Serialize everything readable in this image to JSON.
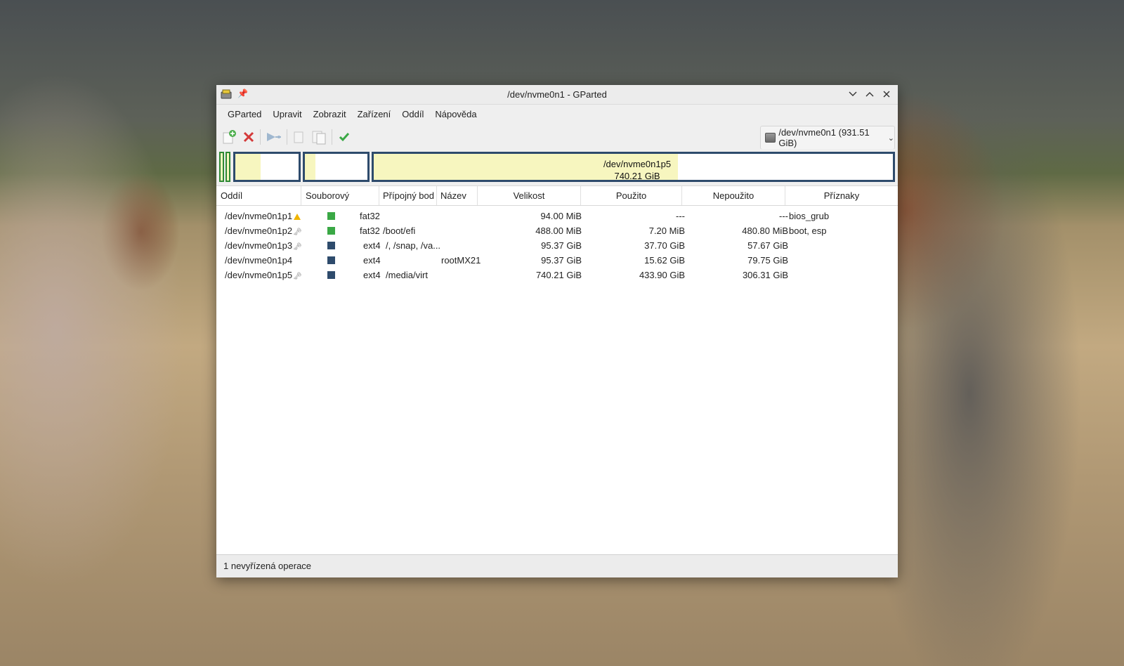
{
  "window": {
    "title": "/dev/nvme0n1 - GParted",
    "controls": [
      "minimize",
      "maximize",
      "close"
    ]
  },
  "menu": [
    "GParted",
    "Upravit",
    "Zobrazit",
    "Zařízení",
    "Oddíl",
    "Nápověda"
  ],
  "toolbar": {
    "icons": [
      "new-partition-icon",
      "delete-icon",
      "resize-move-icon",
      "copy-icon",
      "paste-icon",
      "apply-icon"
    ],
    "device_select": "/dev/nvme0n1 (931.51 GiB)"
  },
  "partition_map": {
    "selected_label": "/dev/nvme0n1p5",
    "selected_size": "740.21 GiB",
    "used_fraction": {
      "nvme0n1p3": 0.395,
      "nvme0n1p4": 0.164,
      "nvme0n1p5": 0.586
    }
  },
  "table": {
    "headers": [
      "Oddíl",
      "Souborový systém",
      "Přípojný bod",
      "Název",
      "Velikost",
      "Použito",
      "Nepoužito",
      "Příznaky"
    ],
    "rows": [
      {
        "partition": "/dev/nvme0n1p1",
        "marker": "warning",
        "fs_color": "#3aa845",
        "fs": "fat32",
        "mount": "",
        "name": "",
        "size": "94.00 MiB",
        "used": "---",
        "unused": "---",
        "flags": "bios_grub"
      },
      {
        "partition": "/dev/nvme0n1p2",
        "marker": "key",
        "fs_color": "#3aa845",
        "fs": "fat32",
        "mount": "/boot/efi",
        "name": "",
        "size": "488.00 MiB",
        "used": "7.20 MiB",
        "unused": "480.80 MiB",
        "flags": "boot, esp"
      },
      {
        "partition": "/dev/nvme0n1p3",
        "marker": "key",
        "fs_color": "#2e4b6c",
        "fs": "ext4",
        "mount": "/, /snap, /va...",
        "name": "",
        "size": "95.37 GiB",
        "used": "37.70 GiB",
        "unused": "57.67 GiB",
        "flags": ""
      },
      {
        "partition": "/dev/nvme0n1p4",
        "marker": "",
        "fs_color": "#2e4b6c",
        "fs": "ext4",
        "mount": "",
        "name": "rootMX21",
        "size": "95.37 GiB",
        "used": "15.62 GiB",
        "unused": "79.75 GiB",
        "flags": ""
      },
      {
        "partition": "/dev/nvme0n1p5",
        "marker": "key",
        "fs_color": "#2e4b6c",
        "fs": "ext4",
        "mount": "/media/virt",
        "name": "",
        "size": "740.21 GiB",
        "used": "433.90 GiB",
        "unused": "306.31 GiB",
        "flags": ""
      }
    ]
  },
  "status": "1 nevyřízená operace"
}
